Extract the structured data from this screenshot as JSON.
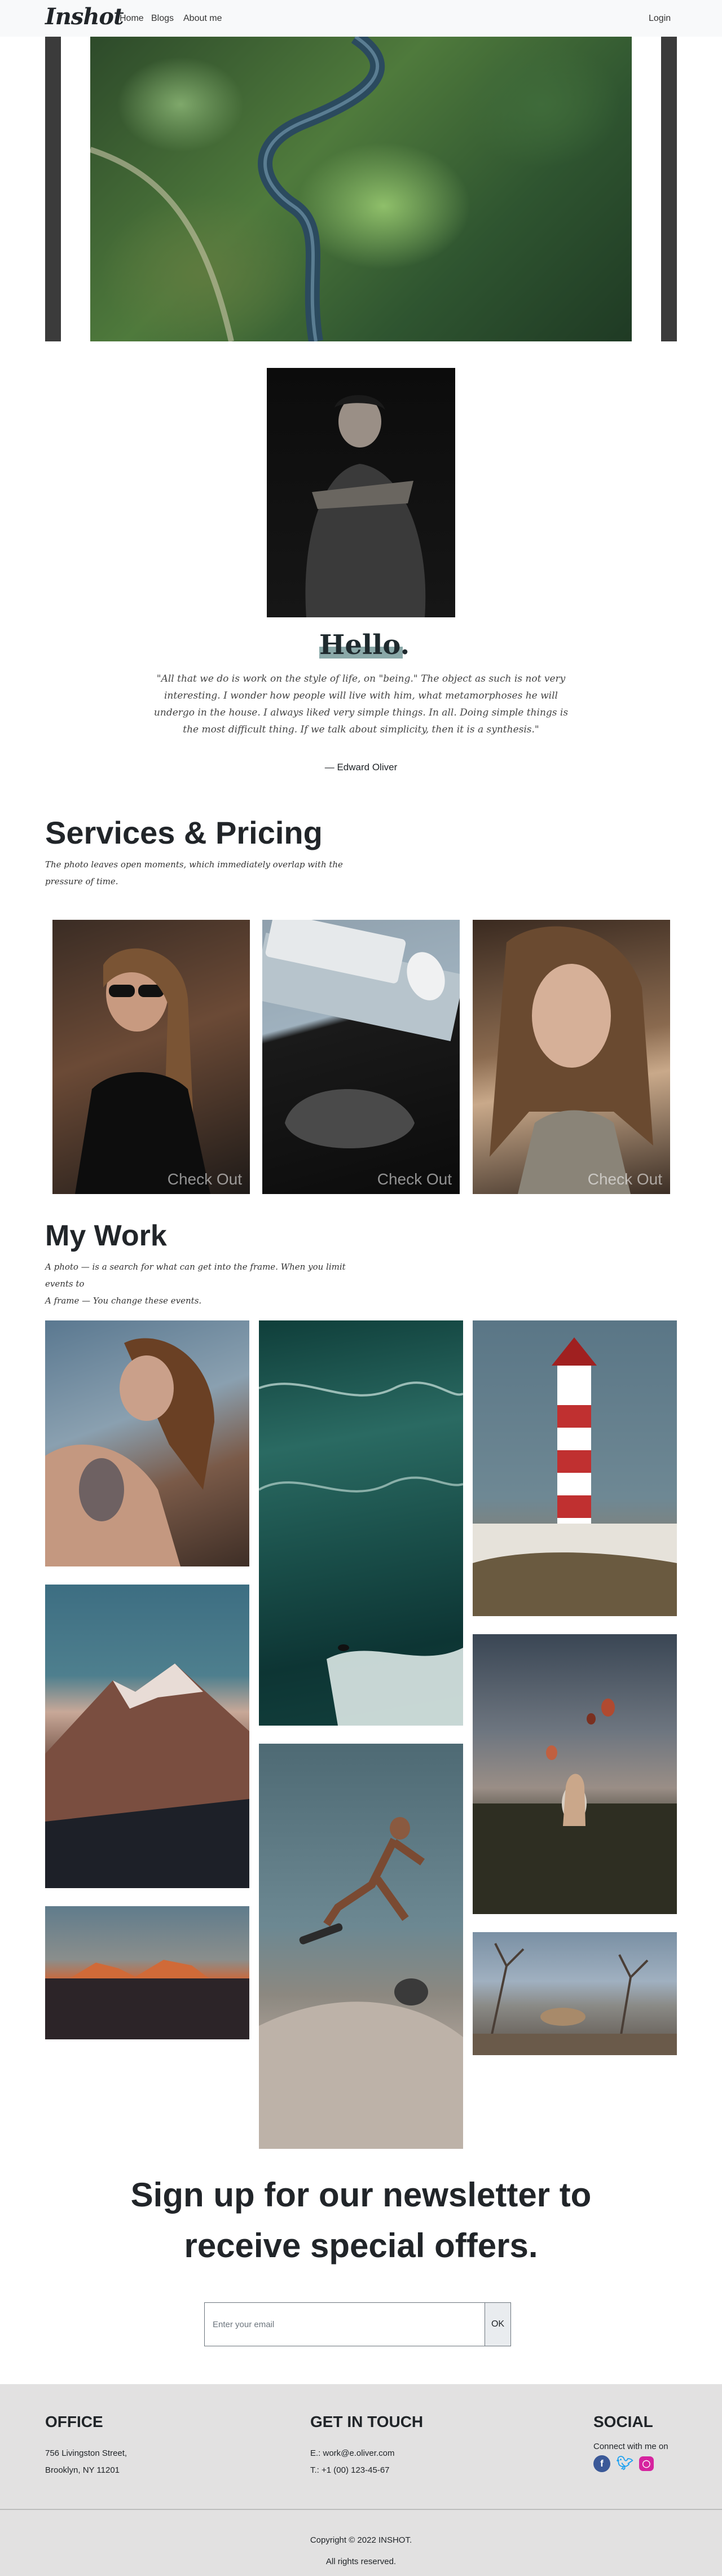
{
  "nav": {
    "brand": "Inshot",
    "links": [
      "Home",
      "Blogs",
      "About me"
    ],
    "login": "Login"
  },
  "intro": {
    "heading": "Hello.",
    "quote": "\"All that we do is work on the style of life, on \"being.\" The object as such is not very interesting. I wonder how people will live with him, what metamorphoses he will undergo in the house. I always liked very simple things. In all. Doing simple things is the most difficult thing. If we talk about simplicity, then it is a synthesis.\"",
    "author": "— Edward Oliver"
  },
  "services": {
    "title": "Services & Pricing",
    "subtitle": "The photo leaves open moments, which immediately overlap with the pressure of time.",
    "cards": [
      {
        "cta": "Check Out"
      },
      {
        "cta": "Check Out"
      },
      {
        "cta": "Check Out"
      }
    ]
  },
  "work": {
    "title": "My Work",
    "line1": "A photo — is a search for what can get into the frame. When you limit events to",
    "line2": "A frame — You change these events."
  },
  "newsletter": {
    "title": "Sign up for our newsletter to receive special offers.",
    "placeholder": "Enter your email",
    "button": "OK"
  },
  "footer": {
    "office": {
      "heading": "OFFICE",
      "line1": "756 Livingston Street,",
      "line2": "Brooklyn, NY 11201"
    },
    "touch": {
      "heading": "GET IN TOUCH",
      "email": "E.: work@e.oliver.com",
      "phone": "T.: +1 (00) 123-45-67"
    },
    "social": {
      "heading": "SOCIAL",
      "text": "Connect with me on",
      "icons": [
        "facebook-icon",
        "twitter-icon",
        "instagram-icon"
      ]
    },
    "copyright": "Copyright © 2022 INSHOT.",
    "rights": "All rights reserved."
  }
}
